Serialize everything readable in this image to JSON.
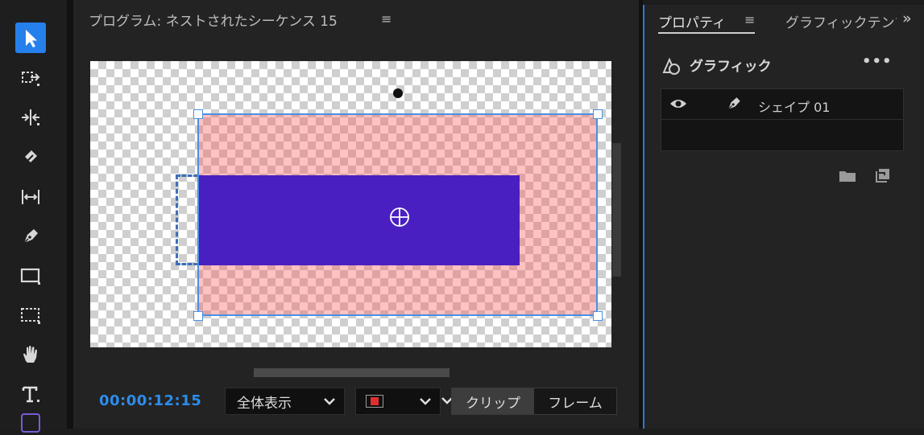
{
  "program": {
    "title": "プログラム: ネストされたシーケンス 15",
    "menu_glyph": "≡",
    "timecode": "00:00:12:15",
    "zoom_select": "全体表示",
    "segment": {
      "clip": "クリップ",
      "frame": "フレーム"
    }
  },
  "tools": {
    "items": [
      {
        "name": "selection-tool",
        "icon": "arrow-icon",
        "active": true
      },
      {
        "name": "track-select-tool",
        "icon": "track-select-icon",
        "active": false
      },
      {
        "name": "ripple-edit-tool",
        "icon": "ripple-icon",
        "active": false
      },
      {
        "name": "razor-tool",
        "icon": "razor-icon",
        "active": false
      },
      {
        "name": "slip-tool",
        "icon": "slip-icon",
        "active": false
      },
      {
        "name": "pen-tool",
        "icon": "pen-icon",
        "active": false
      },
      {
        "name": "rectangle-tool",
        "icon": "rectangle-icon",
        "active": false
      },
      {
        "name": "marquee-tool",
        "icon": "marquee-icon",
        "active": false
      },
      {
        "name": "hand-tool",
        "icon": "hand-icon",
        "active": false
      },
      {
        "name": "type-tool",
        "icon": "type-icon",
        "active": false
      }
    ]
  },
  "properties": {
    "tab_active": "プロパティ",
    "tab_menu_glyph": "≡",
    "tab_other": "グラフィックテンプレート",
    "more_glyph": "»",
    "section_title": "グラフィック",
    "section_more": "•••",
    "layer_name": "シェイプ 01"
  },
  "colors": {
    "accent": "#2680eb",
    "timecode": "#2d8ceb",
    "shape_fill": "#4a1fc2",
    "selection": "#4a90e2"
  }
}
